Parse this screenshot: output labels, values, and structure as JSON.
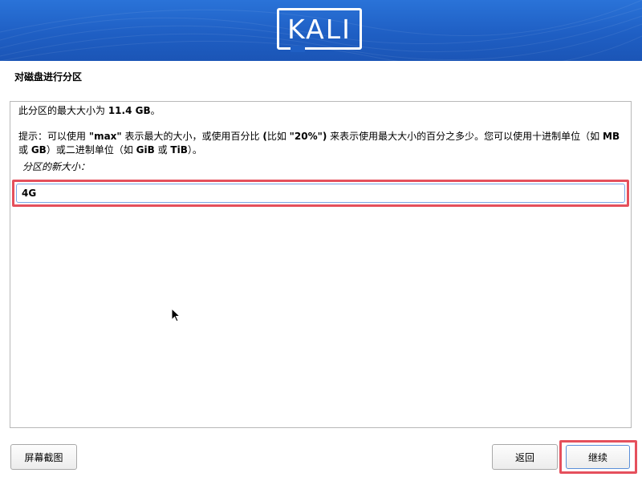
{
  "header": {
    "logo_text": "KALI",
    "brand_color": "#1f5fc4"
  },
  "page": {
    "title": "对磁盘进行分区"
  },
  "panel": {
    "line1": {
      "prefix": "此分区的最大大小为 ",
      "size": "11.4 GB",
      "suffix": "。"
    },
    "hint": {
      "line1_parts": [
        "提示：可以使用 ",
        "\"max\"",
        " 表示最大的大小，或使用百分比 ",
        "(",
        "比如 ",
        "\"20%\")",
        " 来表示使用最大大小的百分之多少。您可以使用十进制单位（如 ",
        "MB"
      ],
      "line2_parts": [
        "或 ",
        "GB",
        "）或二进制单位（如 ",
        "GiB",
        " 或 ",
        "TiB",
        "）。"
      ]
    },
    "field_label": "分区的新大小：",
    "field_value": "4G"
  },
  "footer": {
    "screenshot_label": "屏幕截图",
    "back_label": "返回",
    "continue_label": "继续",
    "highlight_color": "#e5505c"
  }
}
